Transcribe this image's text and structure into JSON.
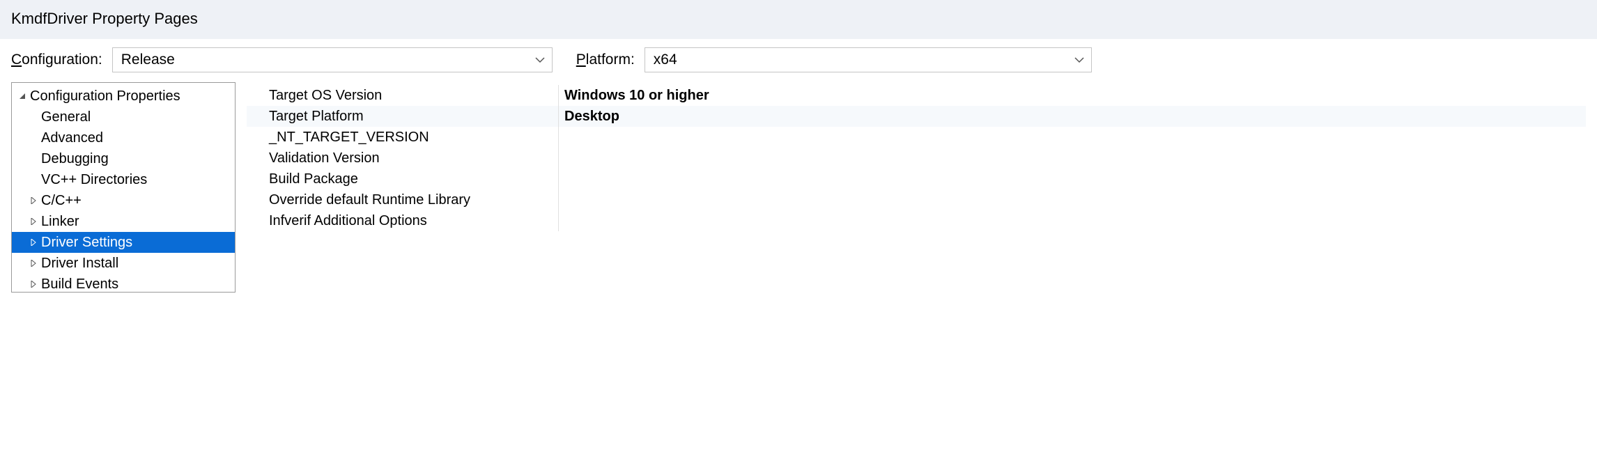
{
  "title": "KmdfDriver Property Pages",
  "config_row": {
    "configuration_label_pre": "C",
    "configuration_label_post": "onfiguration:",
    "configuration_value": "Release",
    "platform_label_pre": "P",
    "platform_label_post": "latform:",
    "platform_value": "x64"
  },
  "tree": [
    {
      "label": "Configuration Properties",
      "indent": 0,
      "arrow": "expanded",
      "selected": false
    },
    {
      "label": "General",
      "indent": 1,
      "arrow": "none",
      "selected": false
    },
    {
      "label": "Advanced",
      "indent": 1,
      "arrow": "none",
      "selected": false
    },
    {
      "label": "Debugging",
      "indent": 1,
      "arrow": "none",
      "selected": false
    },
    {
      "label": "VC++ Directories",
      "indent": 1,
      "arrow": "none",
      "selected": false
    },
    {
      "label": "C/C++",
      "indent": 1,
      "arrow": "collapsed",
      "selected": false
    },
    {
      "label": "Linker",
      "indent": 1,
      "arrow": "collapsed",
      "selected": false
    },
    {
      "label": "Driver Settings",
      "indent": 1,
      "arrow": "collapsed",
      "selected": true
    },
    {
      "label": "Driver Install",
      "indent": 1,
      "arrow": "collapsed",
      "selected": false
    },
    {
      "label": "Build Events",
      "indent": 1,
      "arrow": "collapsed",
      "selected": false
    }
  ],
  "grid": [
    {
      "key": "Target OS Version",
      "value": "Windows 10 or higher"
    },
    {
      "key": "Target Platform",
      "value": "Desktop"
    },
    {
      "key": "_NT_TARGET_VERSION",
      "value": ""
    },
    {
      "key": "Validation Version",
      "value": ""
    },
    {
      "key": "Build Package",
      "value": ""
    },
    {
      "key": "Override default Runtime Library",
      "value": ""
    },
    {
      "key": "Infverif Additional Options",
      "value": ""
    }
  ]
}
